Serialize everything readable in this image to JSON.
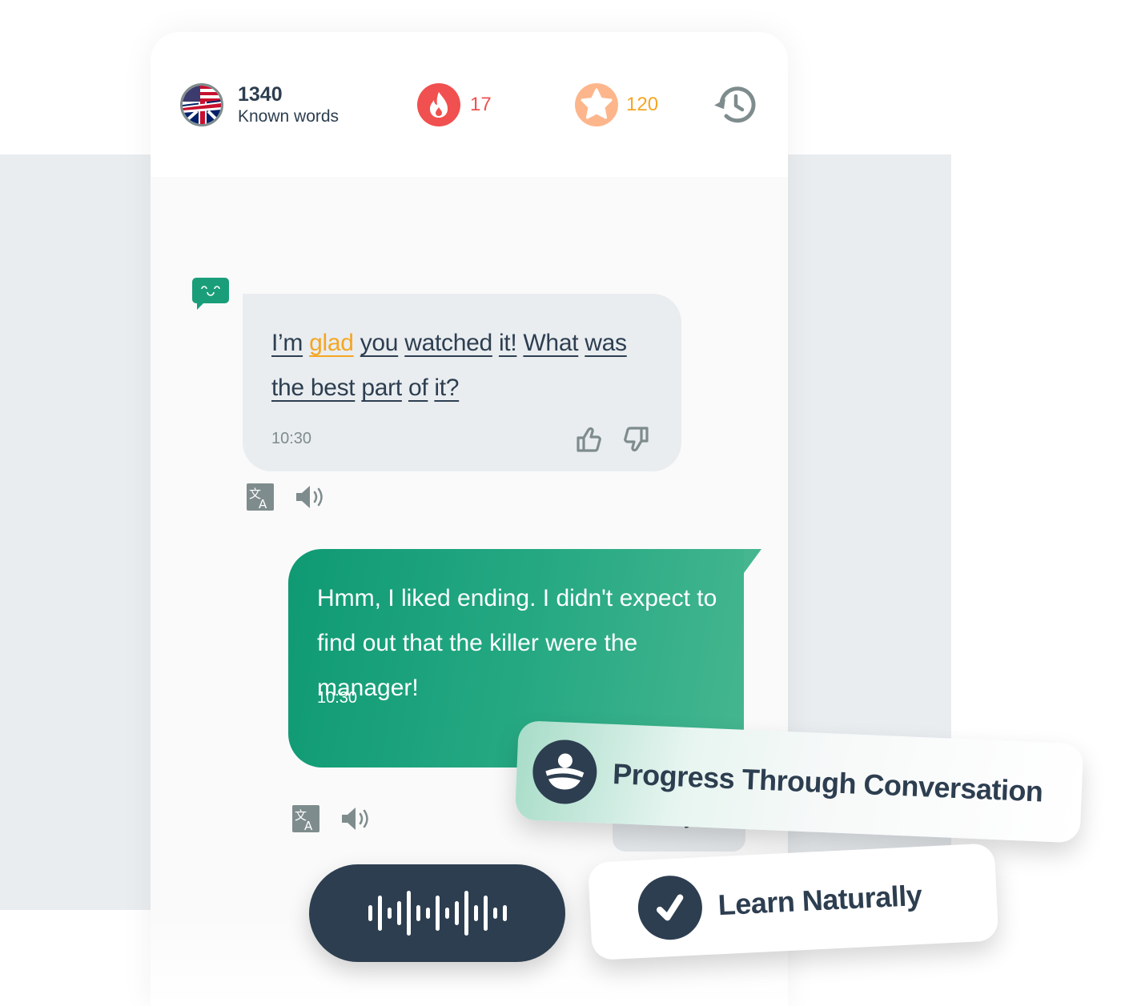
{
  "header": {
    "language_flag": "us-uk-flag-icon",
    "known_words_count": "1340",
    "known_words_label": "Known words",
    "streak_icon": "flame-icon",
    "streak_count": "17",
    "points_icon": "star-icon",
    "points_count": "120",
    "history_icon": "history-clock-icon"
  },
  "colors": {
    "primary_green": "#1a9e7a",
    "dark_navy": "#2d3e50",
    "streak_red": "#f0504f",
    "points_orange": "#f5a623",
    "highlight_word": "#f5a623",
    "icon_gray": "#7f8c8d",
    "bot_bubble": "#e9edf0"
  },
  "chat": {
    "messages": [
      {
        "sender": "bot",
        "avatar_icon": "smiling-chat-bubble-icon",
        "words": [
          "I’m",
          "glad",
          "you",
          "watched",
          "it!",
          "What",
          "was",
          "the best",
          "part",
          "of",
          "it?"
        ],
        "highlighted_word": "glad",
        "time": "10:30",
        "actions": [
          "thumbs-up-icon",
          "thumbs-down-icon",
          "translate-icon",
          "speaker-icon"
        ]
      },
      {
        "sender": "user",
        "text": "Hmm, I liked ending. I didn't expect to find out that the killer were the manager!",
        "time": "10:30",
        "actions": [
          "translate-icon",
          "speaker-icon"
        ]
      }
    ],
    "analyze_label": "Analyze"
  },
  "mic": {
    "icon": "voice-waveform-icon"
  },
  "badges": [
    {
      "label": "Progress Through Conversation",
      "icon": "person-progress-icon"
    },
    {
      "label": "Learn Naturally",
      "icon": "checkmark-icon"
    }
  ]
}
